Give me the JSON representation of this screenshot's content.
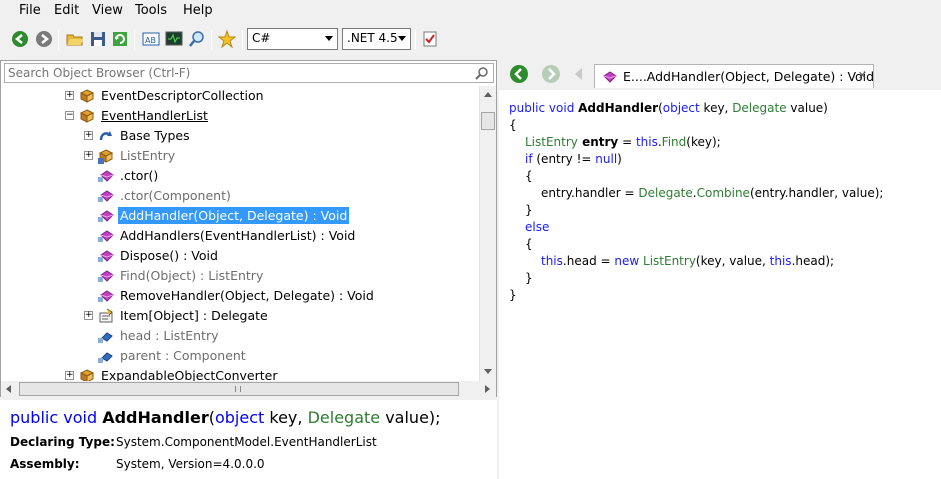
{
  "menu": [
    "File",
    "Edit",
    "View",
    "Tools",
    "Help"
  ],
  "toolbar": {
    "language": "C#",
    "framework": ".NET 4.5"
  },
  "search": {
    "placeholder": "Search Object Browser (Ctrl-F)"
  },
  "tree": [
    {
      "label": "EventDescriptorCollection",
      "expander": "+",
      "icon": "class-icon",
      "style": "normal"
    },
    {
      "label": "EventHandlerList",
      "expander": "−",
      "icon": "class-icon",
      "style": "link"
    },
    {
      "label": "Base Types",
      "expander": "+",
      "icon": "base-types-icon",
      "style": "normal"
    },
    {
      "label": "ListEntry",
      "expander": "+",
      "icon": "nested-class-icon",
      "style": "gray"
    },
    {
      "label": ".ctor()",
      "expander": "",
      "icon": "method-icon",
      "style": "normal"
    },
    {
      "label": ".ctor(Component)",
      "expander": "",
      "icon": "method-icon",
      "style": "gray"
    },
    {
      "label": "AddHandler(Object, Delegate) : Void",
      "expander": "",
      "icon": "method-icon",
      "style": "selected"
    },
    {
      "label": "AddHandlers(EventHandlerList) : Void",
      "expander": "",
      "icon": "method-icon",
      "style": "normal"
    },
    {
      "label": "Dispose() : Void",
      "expander": "",
      "icon": "method-icon",
      "style": "normal"
    },
    {
      "label": "Find(Object) : ListEntry",
      "expander": "",
      "icon": "method-icon",
      "style": "gray"
    },
    {
      "label": "RemoveHandler(Object, Delegate) : Void",
      "expander": "",
      "icon": "method-icon",
      "style": "normal"
    },
    {
      "label": "Item[Object] : Delegate",
      "expander": "+",
      "icon": "property-icon",
      "style": "normal"
    },
    {
      "label": "head : ListEntry",
      "expander": "",
      "icon": "field-icon",
      "style": "gray"
    },
    {
      "label": "parent : Component",
      "expander": "",
      "icon": "field-icon",
      "style": "gray"
    },
    {
      "label": "ExpandableObjectConverter",
      "expander": "+",
      "icon": "class-icon",
      "style": "link"
    }
  ],
  "details": {
    "sig_kw1": "public",
    "sig_kw2": "void",
    "sig_name": "AddHandler",
    "sig_open": "(",
    "sig_kw3": "object",
    "sig_p1": "key,",
    "sig_type": "Delegate",
    "sig_p2": "value);",
    "declaring_label": "Declaring Type:",
    "declaring_value": "System.ComponentModel.EventHandlerList",
    "assembly_label": "Assembly:",
    "assembly_value": "System, Version=4.0.0.0"
  },
  "tab": {
    "title": "E....AddHandler(Object, Delegate) : Void",
    "close": "✕"
  },
  "code": {
    "l1a": "public void ",
    "l1b": "AddHandler",
    "l1c": "(",
    "l1d": "object",
    "l1e": " key, ",
    "l1f": "Delegate",
    "l1g": " value)",
    "l2": "{",
    "l3a": "ListEntry",
    "l3b": " entry",
    "l3c": " = ",
    "l3d": "this",
    "l3e": ".",
    "l3f": "Find",
    "l3g": "(key);",
    "l4a": "if",
    "l4b": " (entry != ",
    "l4c": "null",
    "l4d": ")",
    "l5": "{",
    "l6a": "entry.handler = ",
    "l6b": "Delegate",
    "l6c": ".",
    "l6d": "Combine",
    "l6e": "(entry.handler, value);",
    "l7": "}",
    "l8": "else",
    "l9": "{",
    "l10a": "this",
    "l10b": ".head = ",
    "l10c": "new",
    "l10d": " ",
    "l10e": "ListEntry",
    "l10f": "(key, value, ",
    "l10g": "this",
    "l10h": ".head);",
    "l11": "}",
    "l12": "}"
  }
}
